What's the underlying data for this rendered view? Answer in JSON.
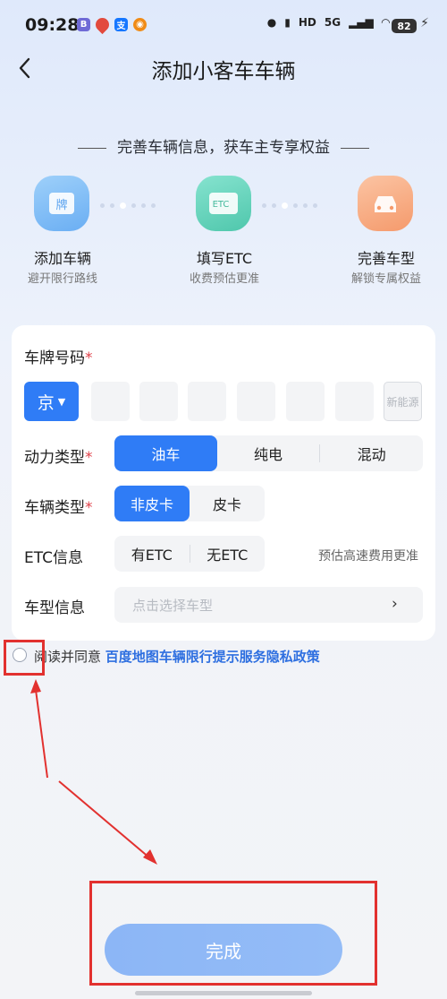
{
  "status_bar": {
    "time": "09:28",
    "app_icons": [
      {
        "name": "app-icon-a",
        "color": "#6f6ad6",
        "glyph": "B"
      },
      {
        "name": "location-pin-icon",
        "color": "#e24a3d",
        "glyph": "●"
      },
      {
        "name": "alipay-icon",
        "color": "#1677ff",
        "glyph": "支"
      },
      {
        "name": "weibo-icon",
        "color": "#f08b16",
        "glyph": "◉"
      }
    ],
    "hd_label": "HD",
    "signal_label": "5G",
    "battery": "82"
  },
  "header": {
    "title": "添加小客车车辆"
  },
  "banner": {
    "text": "完善车辆信息，获车主专享权益"
  },
  "steps": [
    {
      "title": "添加车辆",
      "subtitle": "避开限行路线",
      "icon": "plate-icon",
      "glyph": "牌",
      "bg": "#7fbdf7"
    },
    {
      "title": "填写ETC",
      "subtitle": "收费预估更准",
      "icon": "etc-card-icon",
      "glyph": "ETC",
      "bg": "#5fd1b8"
    },
    {
      "title": "完善车型",
      "subtitle": "解锁专属权益",
      "icon": "car-icon",
      "glyph": "",
      "bg": "#f7a77a"
    }
  ],
  "form": {
    "plate_label": "车牌号码",
    "required_mark": "*",
    "province": "京",
    "new_energy": "新能源",
    "power_label": "动力类型",
    "power_options": [
      "油车",
      "纯电",
      "混动"
    ],
    "vehicle_label": "车辆类型",
    "vehicle_options": [
      "非皮卡",
      "皮卡"
    ],
    "etc_label": "ETC信息",
    "etc_options": [
      "有ETC",
      "无ETC"
    ],
    "etc_hint": "预估高速费用更准",
    "model_label": "车型信息",
    "model_placeholder": "点击选择车型",
    "chevron": "›"
  },
  "agreement": {
    "prefix": "阅读并同意",
    "link": "百度地图车辆限行提示服务隐私政策"
  },
  "submit_label": "完成",
  "colors": {
    "accent": "#2f7cf6",
    "annotation": "#e2312f"
  }
}
